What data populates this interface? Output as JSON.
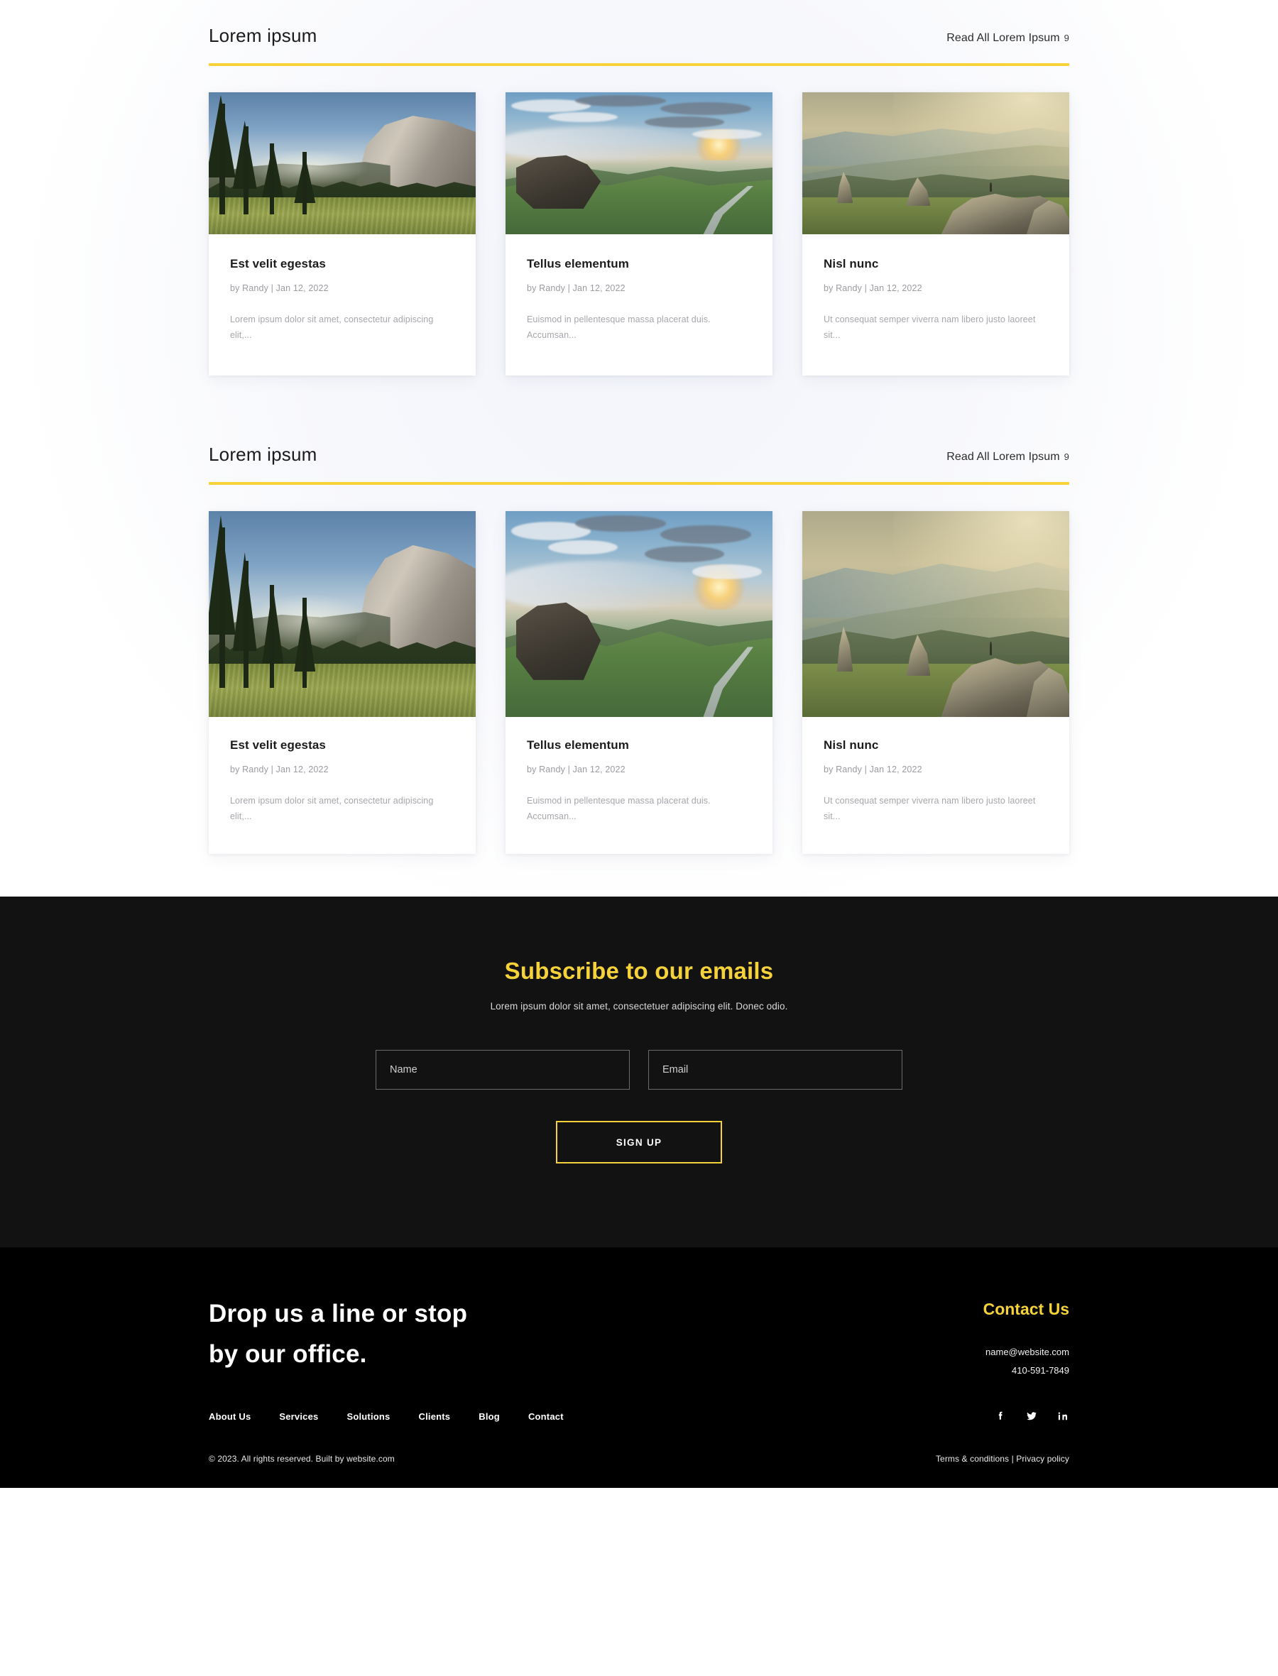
{
  "sections": [
    {
      "title": "Lorem ipsum",
      "read_all_label": "Read All Lorem Ipsum",
      "read_all_arrow": "9",
      "posts": [
        {
          "title": "Est velit egestas",
          "meta": "by Randy | Jan 12, 2022",
          "excerpt": "Lorem ipsum dolor sit amet, consectetur adipiscing elit,...",
          "image_alt": "yosemite-valley-granite-cliff-photo"
        },
        {
          "title": "Tellus elementum",
          "meta": "by Randy | Jan 12, 2022",
          "excerpt": "Euismod in pellentesque massa placerat duis. Accumsan...",
          "image_alt": "green-highland-sunset-winding-road-photo"
        },
        {
          "title": "Nisl nunc",
          "meta": "by Randy | Jan 12, 2022",
          "excerpt": "Ut consequat semper viverra nam libero justo laoreet sit...",
          "image_alt": "hazy-golden-mountain-ridge-hiker-photo"
        }
      ]
    },
    {
      "title": "Lorem ipsum",
      "read_all_label": "Read All Lorem Ipsum",
      "read_all_arrow": "9",
      "posts": [
        {
          "title": "Est velit egestas",
          "meta": "by Randy | Jan 12, 2022",
          "excerpt": "Lorem ipsum dolor sit amet, consectetur adipiscing elit,...",
          "image_alt": "yosemite-valley-granite-cliff-photo"
        },
        {
          "title": "Tellus elementum",
          "meta": "by Randy | Jan 12, 2022",
          "excerpt": "Euismod in pellentesque massa placerat duis. Accumsan...",
          "image_alt": "green-highland-sunset-winding-road-photo"
        },
        {
          "title": "Nisl nunc",
          "meta": "by Randy | Jan 12, 2022",
          "excerpt": "Ut consequat semper viverra nam libero justo laoreet sit...",
          "image_alt": "hazy-golden-mountain-ridge-hiker-photo"
        }
      ]
    }
  ],
  "subscribe": {
    "title": "Subscribe to our emails",
    "subtitle": "Lorem ipsum dolor sit amet, consectetuer adipiscing elit. Donec odio.",
    "name_placeholder": "Name",
    "name_value": "",
    "email_placeholder": "Email",
    "email_value": "",
    "button_label": "SIGN UP"
  },
  "footer": {
    "headline_line1": "Drop us a line or stop",
    "headline_line2": "by our office.",
    "contact_title": "Contact Us",
    "email": "name@website.com",
    "phone": "410-591-7849",
    "nav": [
      {
        "label": "About Us"
      },
      {
        "label": "Services"
      },
      {
        "label": "Solutions"
      },
      {
        "label": "Clients"
      },
      {
        "label": "Blog"
      },
      {
        "label": "Contact"
      }
    ],
    "socials": [
      {
        "name": "facebook"
      },
      {
        "name": "twitter"
      },
      {
        "name": "linkedin"
      }
    ],
    "copyright": "© 2023. All rights reserved. Built by website.com",
    "terms_label": "Terms & conditions",
    "legal_separator": " | ",
    "privacy_label": "Privacy policy"
  },
  "colors": {
    "accent_yellow": "#F5D23A",
    "page_background": "#F6F7FB",
    "subscribe_background": "#121212",
    "footer_background": "#000000"
  }
}
